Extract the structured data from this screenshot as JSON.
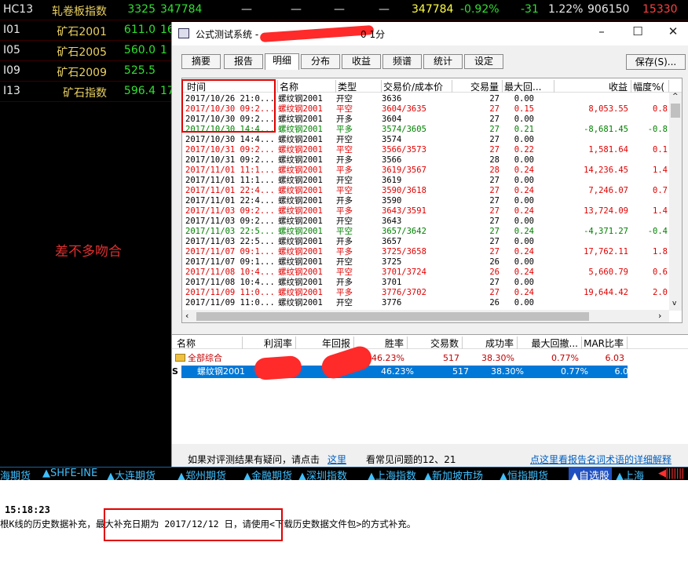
{
  "ticker_rows": [
    {
      "code": "HC13",
      "name": "轧卷板指数",
      "price": "3325",
      "vol": "347784",
      "c1": "—",
      "c2": "—",
      "c3": "—",
      "c4": "—",
      "v2": "347784",
      "pct": "-0.92%",
      "chg": "-31",
      "rate": "1.22%",
      "oi": "906150",
      "last": "15330"
    },
    {
      "code": "I01",
      "name": "矿石2001",
      "price": "611.0",
      "vol": "16"
    },
    {
      "code": "I05",
      "name": "矿石2005",
      "price": "560.0",
      "vol": "1"
    },
    {
      "code": "I09",
      "name": "矿石2009",
      "price": "525.5",
      "vol": ""
    },
    {
      "code": "I13",
      "name": "矿石指数",
      "price": "596.4",
      "vol": "17"
    }
  ],
  "note": "差不多吻合",
  "dialog": {
    "title": "公式测试系统 - ",
    "title_suffix": "0 1分",
    "minimize": "–",
    "maximize": "☐",
    "close": "✕",
    "tabs": [
      "摘要",
      "报告",
      "明细",
      "分布",
      "收益",
      "频谱",
      "统计",
      "设定"
    ],
    "save": "保存(S)..."
  },
  "detail": {
    "headers": [
      "时间",
      "名称",
      "类型",
      "交易价/成本价",
      "交易量",
      "最大回...",
      "收益",
      "幅度%("
    ],
    "rows": [
      {
        "c": "b",
        "t": "2017/10/26 21:0...",
        "n": "螺纹钢2001",
        "k": "开空",
        "p": "3636",
        "q": "27",
        "m": "0.00",
        "r": "",
        "f": ""
      },
      {
        "c": "r",
        "t": "2017/10/30 09:2...",
        "n": "螺纹钢2001",
        "k": "平空",
        "p": "3604/3635",
        "q": "27",
        "m": "0.15",
        "r": "8,053.55",
        "f": "0.8"
      },
      {
        "c": "b",
        "t": "2017/10/30 09:2...",
        "n": "螺纹钢2001",
        "k": "开多",
        "p": "3604",
        "q": "27",
        "m": "0.00",
        "r": "",
        "f": ""
      },
      {
        "c": "g",
        "t": "2017/10/30 14:4...",
        "n": "螺纹钢2001",
        "k": "平多",
        "p": "3574/3605",
        "q": "27",
        "m": "0.21",
        "r": "-8,681.45",
        "f": "-0.8"
      },
      {
        "c": "b",
        "t": "2017/10/30 14:4...",
        "n": "螺纹钢2001",
        "k": "开空",
        "p": "3574",
        "q": "27",
        "m": "0.00",
        "r": "",
        "f": ""
      },
      {
        "c": "r",
        "t": "2017/10/31 09:2...",
        "n": "螺纹钢2001",
        "k": "平空",
        "p": "3566/3573",
        "q": "27",
        "m": "0.22",
        "r": "1,581.64",
        "f": "0.1"
      },
      {
        "c": "b",
        "t": "2017/10/31 09:2...",
        "n": "螺纹钢2001",
        "k": "开多",
        "p": "3566",
        "q": "28",
        "m": "0.00",
        "r": "",
        "f": ""
      },
      {
        "c": "r",
        "t": "2017/11/01 11:1...",
        "n": "螺纹钢2001",
        "k": "平多",
        "p": "3619/3567",
        "q": "28",
        "m": "0.24",
        "r": "14,236.45",
        "f": "1.4"
      },
      {
        "c": "b",
        "t": "2017/11/01 11:1...",
        "n": "螺纹钢2001",
        "k": "开空",
        "p": "3619",
        "q": "27",
        "m": "0.00",
        "r": "",
        "f": ""
      },
      {
        "c": "r",
        "t": "2017/11/01 22:4...",
        "n": "螺纹钢2001",
        "k": "平空",
        "p": "3590/3618",
        "q": "27",
        "m": "0.24",
        "r": "7,246.07",
        "f": "0.7"
      },
      {
        "c": "b",
        "t": "2017/11/01 22:4...",
        "n": "螺纹钢2001",
        "k": "开多",
        "p": "3590",
        "q": "27",
        "m": "0.00",
        "r": "",
        "f": ""
      },
      {
        "c": "r",
        "t": "2017/11/03 09:2...",
        "n": "螺纹钢2001",
        "k": "平多",
        "p": "3643/3591",
        "q": "27",
        "m": "0.24",
        "r": "13,724.09",
        "f": "1.4"
      },
      {
        "c": "b",
        "t": "2017/11/03 09:2...",
        "n": "螺纹钢2001",
        "k": "开空",
        "p": "3643",
        "q": "27",
        "m": "0.00",
        "r": "",
        "f": ""
      },
      {
        "c": "g",
        "t": "2017/11/03 22:5...",
        "n": "螺纹钢2001",
        "k": "平空",
        "p": "3657/3642",
        "q": "27",
        "m": "0.24",
        "r": "-4,371.27",
        "f": "-0.4"
      },
      {
        "c": "b",
        "t": "2017/11/03 22:5...",
        "n": "螺纹钢2001",
        "k": "开多",
        "p": "3657",
        "q": "27",
        "m": "0.00",
        "r": "",
        "f": ""
      },
      {
        "c": "r",
        "t": "2017/11/07 09:1...",
        "n": "螺纹钢2001",
        "k": "平多",
        "p": "3725/3658",
        "q": "27",
        "m": "0.24",
        "r": "17,762.11",
        "f": "1.8"
      },
      {
        "c": "b",
        "t": "2017/11/07 09:1...",
        "n": "螺纹钢2001",
        "k": "开空",
        "p": "3725",
        "q": "26",
        "m": "0.00",
        "r": "",
        "f": ""
      },
      {
        "c": "r",
        "t": "2017/11/08 10:4...",
        "n": "螺纹钢2001",
        "k": "平空",
        "p": "3701/3724",
        "q": "26",
        "m": "0.24",
        "r": "5,660.79",
        "f": "0.6"
      },
      {
        "c": "b",
        "t": "2017/11/08 10:4...",
        "n": "螺纹钢2001",
        "k": "开多",
        "p": "3701",
        "q": "27",
        "m": "0.00",
        "r": "",
        "f": ""
      },
      {
        "c": "r",
        "t": "2017/11/09 11:0...",
        "n": "螺纹钢2001",
        "k": "平多",
        "p": "3776/3702",
        "q": "27",
        "m": "0.24",
        "r": "19,644.42",
        "f": "2.0"
      },
      {
        "c": "b",
        "t": "2017/11/09 11:0...",
        "n": "螺纹钢2001",
        "k": "开空",
        "p": "3776",
        "q": "26",
        "m": "0.00",
        "r": "",
        "f": ""
      }
    ]
  },
  "summary": {
    "headers": [
      "名称",
      "利润率",
      "年回报",
      "胜率",
      "交易数",
      "成功率",
      "最大回撤...",
      "MAR比率"
    ],
    "rows": [
      {
        "name": "全部综合",
        "win": "46.23%",
        "trades": "517",
        "success": "38.30%",
        "dd": "0.77%",
        "mar": "6.03"
      },
      {
        "name": "螺纹钢2001",
        "prefix": "S",
        "win": "46.23%",
        "trades": "517",
        "success": "38.30%",
        "dd": "0.77%",
        "mar": "6.03"
      }
    ]
  },
  "footer": {
    "q": "如果对评测结果有疑问，请点击",
    "here": "这里",
    "faq": "看常见问题的12、21",
    "link": "点这里看报告名词术语的详细解释"
  },
  "bar": [
    "海期货",
    "▲SHFE-INE",
    "▲大连期货",
    "▲郑州期货",
    "▲金融期货",
    "▲深圳指数",
    "▲上海指数",
    "▲新加坡市场",
    "▲恒指期货",
    "▲自选股",
    "▲上海"
  ],
  "console": {
    "time": "15:18:23",
    "msg": "根K线的历史数据补充，最大补充日期为 2017/12/12 日，请使用<下载历史数据文件包>的方式补充。"
  }
}
